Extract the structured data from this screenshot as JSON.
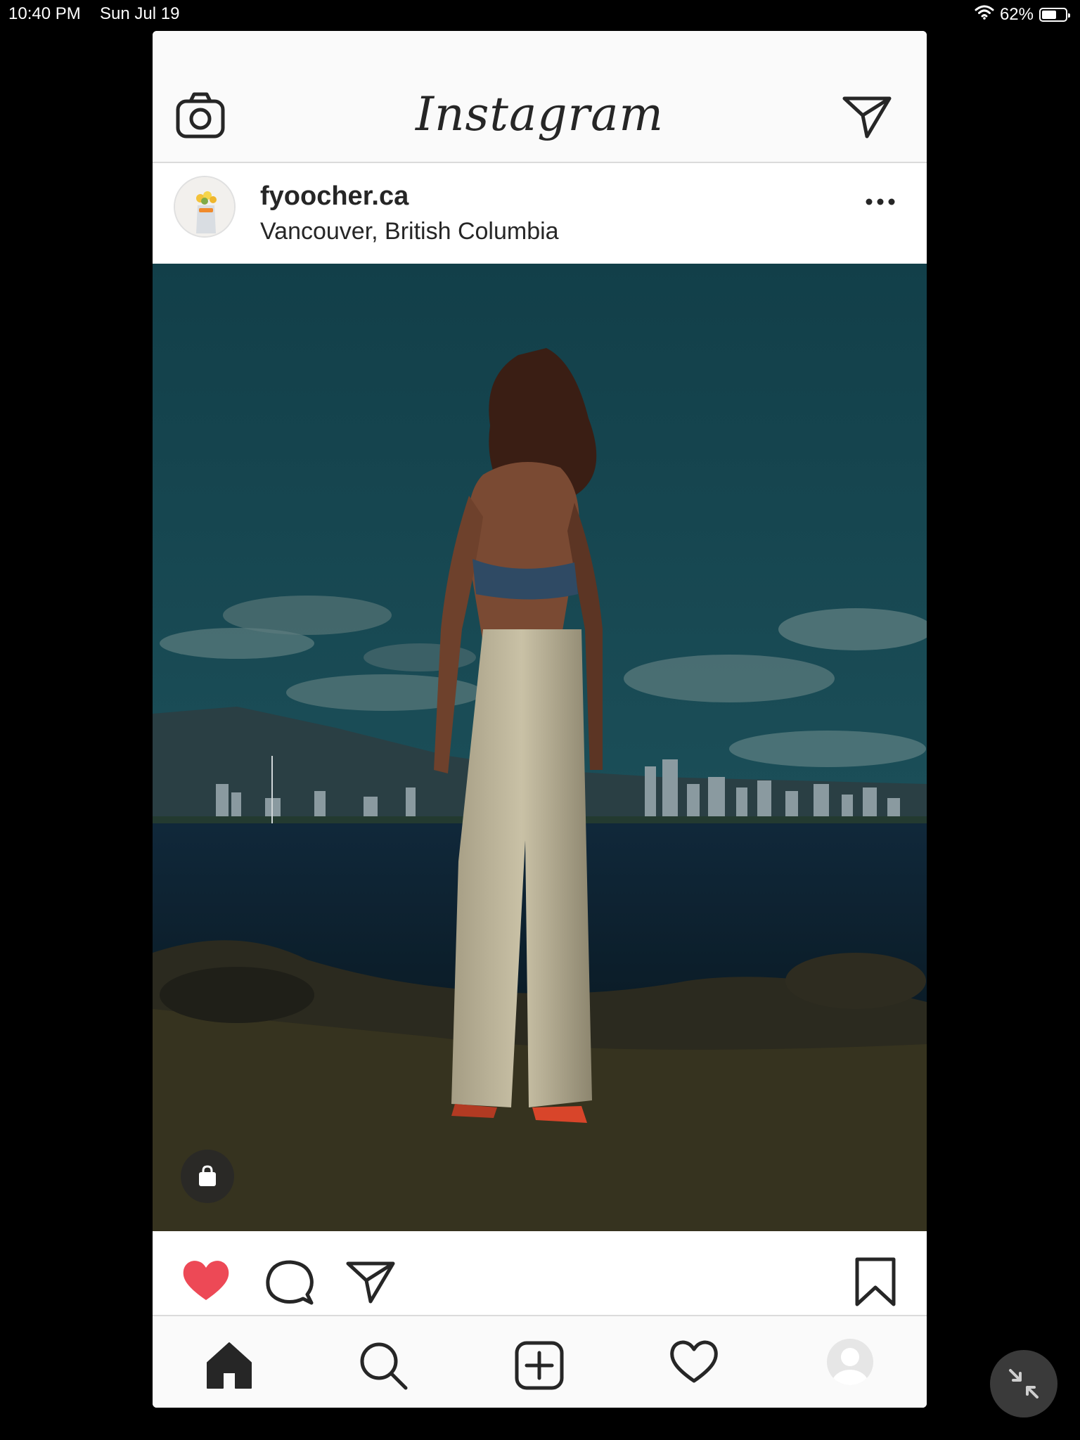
{
  "status_bar": {
    "time": "10:40 PM",
    "date": "Sun Jul 19",
    "battery": "62%",
    "battery_level": 0.62,
    "icons": [
      "wifi-icon",
      "battery-icon"
    ]
  },
  "header": {
    "app_title": "Instagram",
    "left_icon": "camera-icon",
    "right_icon": "direct-message-icon"
  },
  "post": {
    "username": "fyoocher.ca",
    "location": "Vancouver, British Columbia",
    "menu_icon": "more-options-icon",
    "shopping_icon": "shopping-bag-icon",
    "liked": true
  },
  "actions": {
    "icons": [
      "heart-filled-icon",
      "comment-icon",
      "share-icon",
      "bookmark-icon"
    ],
    "like_color": "#ed4956"
  },
  "tab_bar": {
    "icons": [
      "home-icon",
      "search-icon",
      "add-post-icon",
      "activity-heart-icon",
      "profile-icon"
    ]
  },
  "overlay": {
    "icon": "minimize-icon"
  }
}
